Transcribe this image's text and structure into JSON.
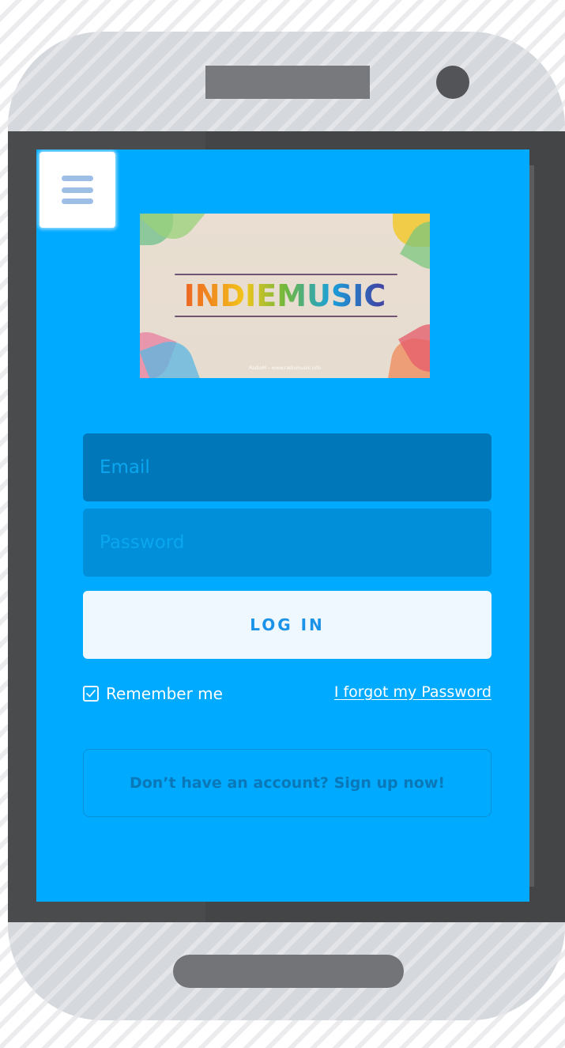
{
  "app": {
    "brand": "INDIEMUSIC",
    "banner_footer": "RadioM – www.radiomusic.info"
  },
  "login": {
    "email_placeholder": "Email",
    "password_placeholder": "Password",
    "login_label": "LOG IN",
    "remember_label": "Remember me",
    "remember_checked": true,
    "forgot_label": "I forgot my Password",
    "signup_label": "Don’t have an account? Sign up now!"
  },
  "icons": {
    "menu": "hamburger-menu-icon",
    "checkbox": "checkmark-icon",
    "speaker": "phone-speaker",
    "camera": "phone-camera",
    "home": "phone-home-button"
  },
  "colors": {
    "screen_background": "#00aaff",
    "email_field": "#0077b8",
    "password_field": "#008fd8",
    "login_button": "#f0f8ff",
    "login_text": "#1a92e8",
    "signup_text": "#0a78b8",
    "phone_body": "#d3d6da",
    "phone_bezel": "#4a4b4d"
  }
}
